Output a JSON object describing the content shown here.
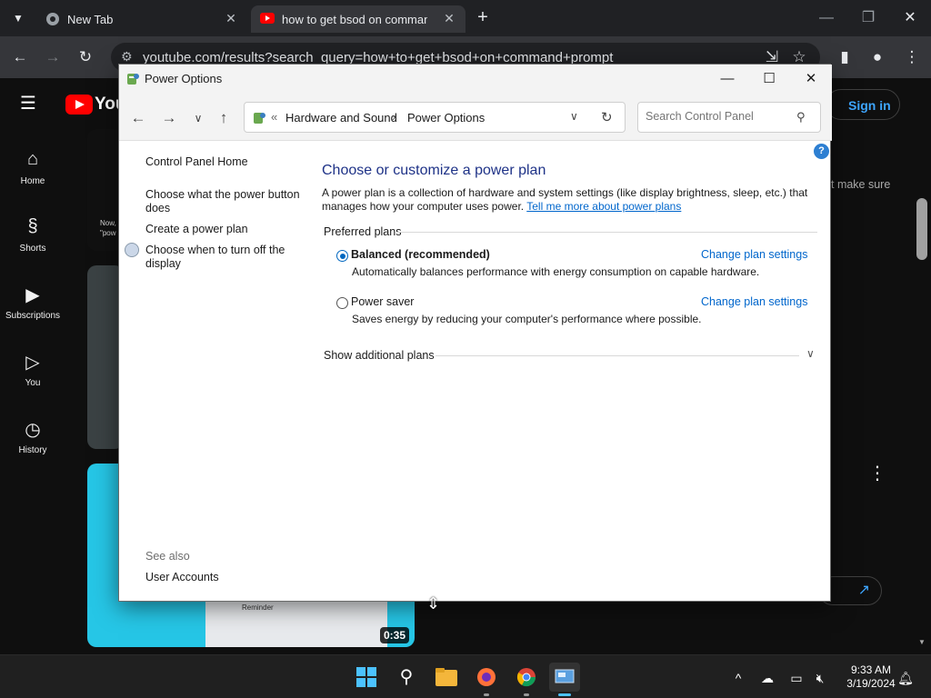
{
  "browser": {
    "tabs": [
      {
        "title": "New Tab"
      },
      {
        "title": "how to get bsod on command"
      }
    ],
    "url": "youtube.com/results?search_query=how+to+get+bsod+on+command+prompt"
  },
  "youtube": {
    "sign_in": "Sign in",
    "nav": [
      {
        "label": "Home",
        "icon": "home-icon"
      },
      {
        "label": "Shorts",
        "icon": "shorts-icon"
      },
      {
        "label": "Subscriptions",
        "icon": "subscriptions-icon"
      },
      {
        "label": "You",
        "icon": "you-icon"
      },
      {
        "label": "History",
        "icon": "history-icon"
      }
    ],
    "snippet_right": "t make sure",
    "thumb_caption_1": "Now,",
    "thumb_caption_2": "\"pow",
    "thumb_reminder": "Reminder",
    "video_duration": "0:35",
    "logo_text": "You"
  },
  "power_window": {
    "title": "Power Options",
    "breadcrumb": [
      "Hardware and Sound",
      "Power Options"
    ],
    "breadcrumb_prefix": "«",
    "search_placeholder": "Search Control Panel",
    "sidebar": {
      "home": "Control Panel Home",
      "links": [
        "Choose what the power button does",
        "Create a power plan",
        "Choose when to turn off the display"
      ],
      "see_also_label": "See also",
      "see_also": [
        "User Accounts"
      ]
    },
    "heading": "Choose or customize a power plan",
    "intro": "A power plan is a collection of hardware and system settings (like display brightness, sleep, etc.) that manages how your computer uses power.",
    "intro_link": "Tell me more about power plans",
    "preferred_label": "Preferred plans",
    "plans": [
      {
        "name": "Balanced (recommended)",
        "desc": "Automatically balances performance with energy consumption on capable hardware.",
        "link": "Change plan settings",
        "selected": true
      },
      {
        "name": "Power saver",
        "desc": "Saves energy by reducing your computer's performance where possible.",
        "link": "Change plan settings",
        "selected": false
      }
    ],
    "show_additional": "Show additional plans"
  },
  "taskbar": {
    "time": "9:33 AM",
    "date": "3/19/2024"
  }
}
